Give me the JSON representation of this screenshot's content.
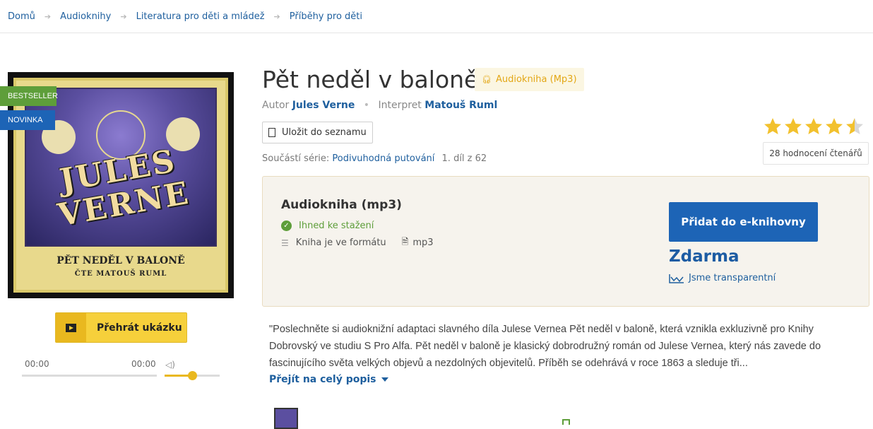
{
  "breadcrumb": [
    "Domů",
    "Audioknihy",
    "Literatura pro děti a mládež",
    "Příběhy pro děti"
  ],
  "cover": {
    "badges": {
      "bestseller": "BESTSELLER",
      "novinka": "NOVINKA"
    },
    "art_title": "JULES VERNE",
    "art_subtitle": "PĚT NEDĚL V BALONĚ",
    "art_reader": "ČTE MATOUŠ RUML"
  },
  "player": {
    "play_label": "Přehrát ukázku",
    "current_time": "00:00",
    "duration": "00:00",
    "volume_level": 0.5
  },
  "product": {
    "title": "Pět neděl v baloně",
    "format_tag": "Audiokniha (Mp3)",
    "author_label": "Autor",
    "author": "Jules Verne",
    "interpret_label": "Interpret",
    "interpret": "Matouš Ruml",
    "save_label": "Uložit do seznamu",
    "series_label": "Součástí série:",
    "series_name": "Podivuhodná putování",
    "series_part": "1. díl z 62"
  },
  "rating": {
    "value": 4.5,
    "max": 5,
    "count_label": "28 hodnocení čtenářů",
    "star_color": "#f2c12e"
  },
  "buy": {
    "title": "Audiokniha (mp3)",
    "availability": "Ihned ke stažení",
    "format_label": "Kniha je ve formátu",
    "format_value": "mp3",
    "add_button": "Přidat do e-knihovny",
    "price": "Zdarma",
    "transparent_label": "Jsme transparentní"
  },
  "description": {
    "text": "\"Poslechněte si audioknižní adaptaci slavného díla Julese Vernea Pět neděl v baloně, která vznikla exkluzivně pro Knihy Dobrovský ve studiu S Pro Alfa. Pět neděl v baloně je klasický dobrodružný román od Julese Vernea, který nás zavede do fascinujícího světa velkých objevů a nezdolných objevitelů. Příběh se odehrává v roce 1863 a sleduje tři...",
    "more_label": "Přejít na celý popis"
  },
  "colors": {
    "brand_blue": "#1d64b6",
    "accent_yellow": "#f6d03b",
    "success_green": "#5e9e3a"
  }
}
